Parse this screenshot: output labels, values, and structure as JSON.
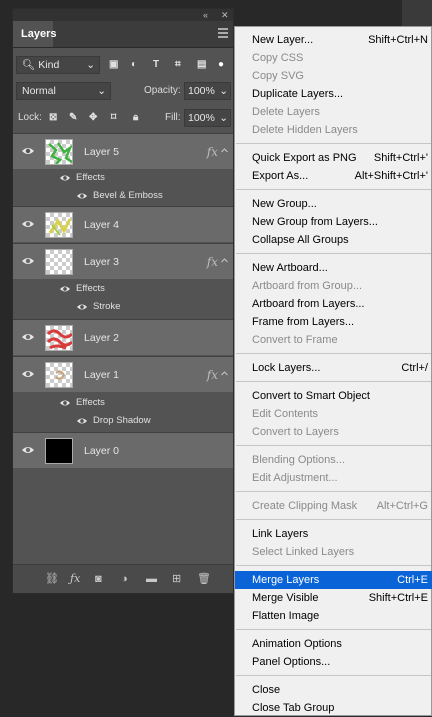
{
  "panel": {
    "tab_title": "Layers",
    "filter_kind": "Kind",
    "blend_mode": "Normal",
    "opacity_label": "Opacity:",
    "opacity_value": "100%",
    "lock_label": "Lock:",
    "fill_label": "Fill:",
    "fill_value": "100%"
  },
  "layers": [
    {
      "name": "Layer 5",
      "fx": "fx",
      "effects_label": "Effects",
      "effects": [
        "Bevel & Emboss"
      ]
    },
    {
      "name": "Layer 4"
    },
    {
      "name": "Layer 3",
      "fx": "fx",
      "effects_label": "Effects",
      "effects": [
        "Stroke"
      ]
    },
    {
      "name": "Layer 2"
    },
    {
      "name": "Layer 1",
      "fx": "fx",
      "effects_label": "Effects",
      "effects": [
        "Drop Shadow"
      ]
    },
    {
      "name": "Layer 0"
    }
  ],
  "menu": [
    {
      "label": "New Layer...",
      "shortcut": "Shift+Ctrl+N"
    },
    {
      "label": "Copy CSS",
      "disabled": true
    },
    {
      "label": "Copy SVG",
      "disabled": true
    },
    {
      "label": "Duplicate Layers..."
    },
    {
      "label": "Delete Layers",
      "disabled": true
    },
    {
      "label": "Delete Hidden Layers",
      "disabled": true
    },
    {
      "label": "Quick Export as PNG",
      "shortcut": "Shift+Ctrl+'"
    },
    {
      "label": "Export As...",
      "shortcut": "Alt+Shift+Ctrl+'"
    },
    {
      "label": "New Group..."
    },
    {
      "label": "New Group from Layers..."
    },
    {
      "label": "Collapse All Groups"
    },
    {
      "label": "New Artboard..."
    },
    {
      "label": "Artboard from Group...",
      "disabled": true
    },
    {
      "label": "Artboard from Layers..."
    },
    {
      "label": "Frame from Layers..."
    },
    {
      "label": "Convert to Frame",
      "disabled": true
    },
    {
      "label": "Lock Layers...",
      "shortcut": "Ctrl+/"
    },
    {
      "label": "Convert to Smart Object"
    },
    {
      "label": "Edit Contents",
      "disabled": true
    },
    {
      "label": "Convert to Layers",
      "disabled": true
    },
    {
      "label": "Blending Options...",
      "disabled": true
    },
    {
      "label": "Edit Adjustment...",
      "disabled": true
    },
    {
      "label": "Create Clipping Mask",
      "shortcut": "Alt+Ctrl+G",
      "disabled": true
    },
    {
      "label": "Link Layers"
    },
    {
      "label": "Select Linked Layers",
      "disabled": true
    },
    {
      "label": "Merge Layers",
      "shortcut": "Ctrl+E",
      "highlighted": true
    },
    {
      "label": "Merge Visible",
      "shortcut": "Shift+Ctrl+E"
    },
    {
      "label": "Flatten Image"
    },
    {
      "label": "Animation Options"
    },
    {
      "label": "Panel Options..."
    },
    {
      "label": "Close"
    },
    {
      "label": "Close Tab Group"
    }
  ]
}
